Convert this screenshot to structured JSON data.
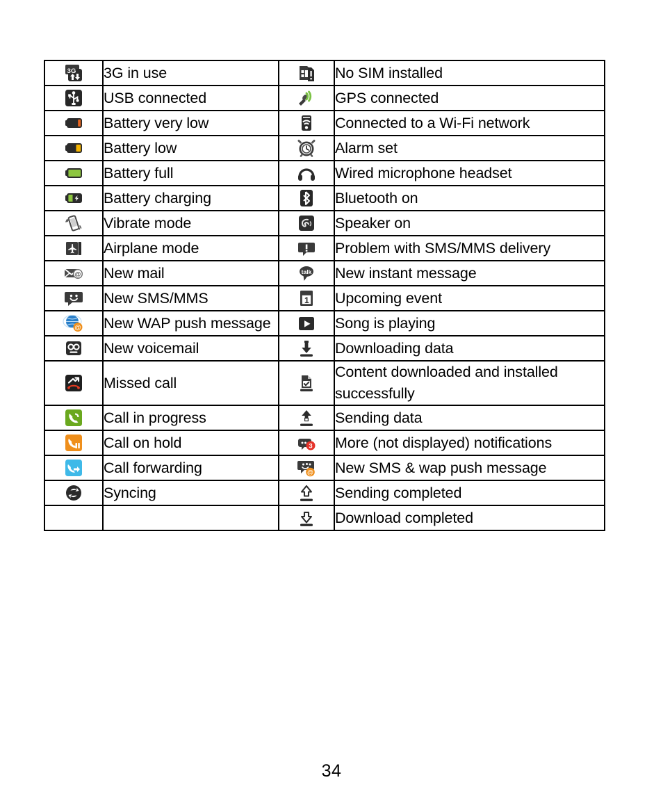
{
  "document": {
    "page_number": "34",
    "table": {
      "rows": [
        {
          "left": {
            "icon": "3g-in-use-icon",
            "label": "3G in use"
          },
          "right": {
            "icon": "no-sim-icon",
            "label": "No SIM installed"
          }
        },
        {
          "left": {
            "icon": "usb-connected-icon",
            "label": "USB connected"
          },
          "right": {
            "icon": "gps-connected-icon",
            "label": "GPS connected"
          }
        },
        {
          "left": {
            "icon": "battery-very-low-icon",
            "label": "Battery very low"
          },
          "right": {
            "icon": "wifi-connected-icon",
            "label": "Connected to a Wi-Fi network"
          }
        },
        {
          "left": {
            "icon": "battery-low-icon",
            "label": "Battery low"
          },
          "right": {
            "icon": "alarm-clock-icon",
            "label": "Alarm set"
          }
        },
        {
          "left": {
            "icon": "battery-full-icon",
            "label": "Battery full"
          },
          "right": {
            "icon": "headset-icon",
            "label": "Wired microphone headset"
          }
        },
        {
          "left": {
            "icon": "battery-charging-icon",
            "label": "Battery charging"
          },
          "right": {
            "icon": "bluetooth-icon",
            "label": "Bluetooth on"
          }
        },
        {
          "left": {
            "icon": "vibrate-mode-icon",
            "label": "Vibrate mode"
          },
          "right": {
            "icon": "speaker-on-icon",
            "label": "Speaker on"
          }
        },
        {
          "left": {
            "icon": "airplane-mode-icon",
            "label": "Airplane mode"
          },
          "right": {
            "icon": "sms-problem-icon",
            "label": "Problem with SMS/MMS delivery"
          }
        },
        {
          "left": {
            "icon": "new-mail-icon",
            "label": "New mail"
          },
          "right": {
            "icon": "talk-icon",
            "label": "New instant message"
          }
        },
        {
          "left": {
            "icon": "new-sms-mms-icon",
            "label": "New SMS/MMS"
          },
          "right": {
            "icon": "calendar-event-icon",
            "label": "Upcoming event"
          }
        },
        {
          "left": {
            "icon": "wap-push-icon",
            "label": "New WAP push message"
          },
          "right": {
            "icon": "play-icon",
            "label": "Song is playing"
          }
        },
        {
          "left": {
            "icon": "voicemail-icon",
            "label": "New voicemail"
          },
          "right": {
            "icon": "downloading-icon",
            "label": "Downloading data"
          }
        },
        {
          "left": {
            "icon": "missed-call-icon",
            "label": "Missed call"
          },
          "right": {
            "icon": "install-success-icon",
            "label": "Content downloaded and installed successfully"
          }
        },
        {
          "left": {
            "icon": "call-in-progress-icon",
            "label": "Call in progress"
          },
          "right": {
            "icon": "sending-data-icon",
            "label": "Sending data"
          }
        },
        {
          "left": {
            "icon": "call-on-hold-icon",
            "label": "Call on hold"
          },
          "right": {
            "icon": "more-notifications-icon",
            "label": "More (not displayed) notifications"
          }
        },
        {
          "left": {
            "icon": "call-forwarding-icon",
            "label": "Call forwarding"
          },
          "right": {
            "icon": "sms-wap-push-icon",
            "label": "New SMS & wap push message"
          }
        },
        {
          "left": {
            "icon": "syncing-icon",
            "label": "Syncing"
          },
          "right": {
            "icon": "sending-completed-icon",
            "label": "Sending completed"
          }
        },
        {
          "left": {
            "icon": "",
            "label": ""
          },
          "right": {
            "icon": "download-completed-icon",
            "label": "Download completed"
          }
        }
      ]
    },
    "colors": {
      "border": "#000000",
      "text": "#000000",
      "background": "#ffffff",
      "battery_very_low": "#e8641e",
      "battery_low": "#f5b400",
      "battery_full": "#8dc63f",
      "battery_charging": "#8dc63f",
      "gps_green": "#7ac143",
      "call_in_progress_green": "#6aa81e",
      "call_on_hold_orange": "#ef8f1c",
      "call_forwarding_blue": "#3fb9e8",
      "missed_call_red": "#e03a21",
      "badge_red": "#e5332a",
      "wap_globe_blue": "#2a7fc9",
      "wap_at_orange": "#ef8f1c",
      "icon_dark": "#2b2b2b"
    }
  }
}
